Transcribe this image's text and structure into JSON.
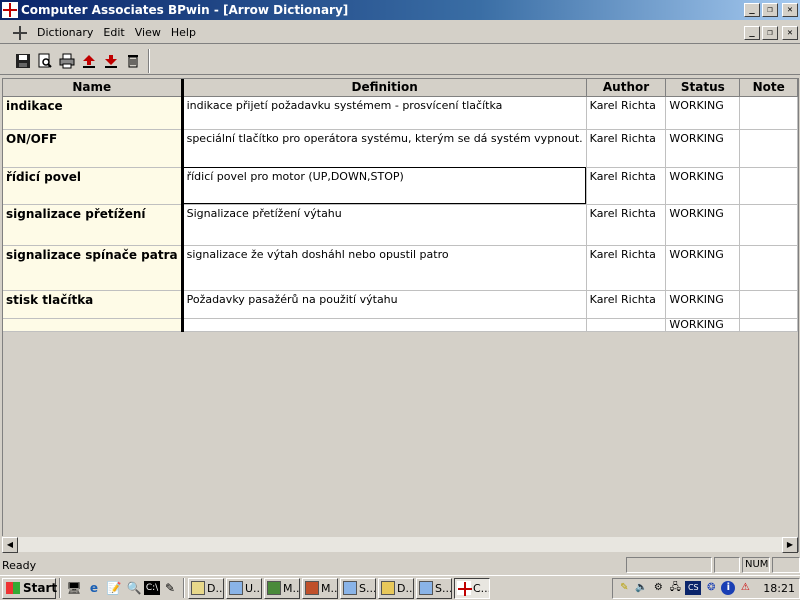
{
  "window": {
    "title": "Computer Associates BPwin - [Arrow Dictionary]"
  },
  "menu": {
    "items": [
      "Dictionary",
      "Edit",
      "View",
      "Help"
    ]
  },
  "toolbar": {
    "buttons": [
      "save-icon",
      "print-preview-icon",
      "print-icon",
      "import-icon",
      "export-icon",
      "delete-icon"
    ]
  },
  "table": {
    "headers": [
      "Name",
      "Definition",
      "Author",
      "Status",
      "Note"
    ],
    "rows": [
      {
        "name": "indikace",
        "definition": "indikace přijetí požadavku systémem - prosvícení tlačítka",
        "author": "Karel Richta",
        "status": "WORKING",
        "note": ""
      },
      {
        "name": "ON/OFF",
        "definition": "speciální tlačítko pro operátora systému, kterým se dá systém vypnout.",
        "author": "Karel Richta",
        "status": "WORKING",
        "note": ""
      },
      {
        "name": "řídicí povel",
        "definition": "řídicí povel pro motor (UP,DOWN,STOP)",
        "author": "Karel Richta",
        "status": "WORKING",
        "note": ""
      },
      {
        "name": "signalizace přetížení",
        "definition": "Signalizace přetížení výtahu",
        "author": "Karel Richta",
        "status": "WORKING",
        "note": ""
      },
      {
        "name": "signalizace spínače patra",
        "definition": "signalizace že výtah dosháhl nebo opustil patro",
        "author": "Karel Richta",
        "status": "WORKING",
        "note": ""
      },
      {
        "name": "stisk tlačítka",
        "definition": "Požadavky pasažérů na použití výtahu",
        "author": "Karel Richta",
        "status": "WORKING",
        "note": ""
      },
      {
        "name": "",
        "definition": "",
        "author": "",
        "status": "WORKING",
        "note": ""
      }
    ]
  },
  "statusbar": {
    "text": "Ready",
    "num": "NUM"
  },
  "taskbar": {
    "start": "Start",
    "tasks": [
      "D...",
      "U...",
      "M...",
      "M...",
      "S...",
      "D...",
      "S...",
      "C..."
    ],
    "clock": "18:21",
    "lang": "CS"
  }
}
